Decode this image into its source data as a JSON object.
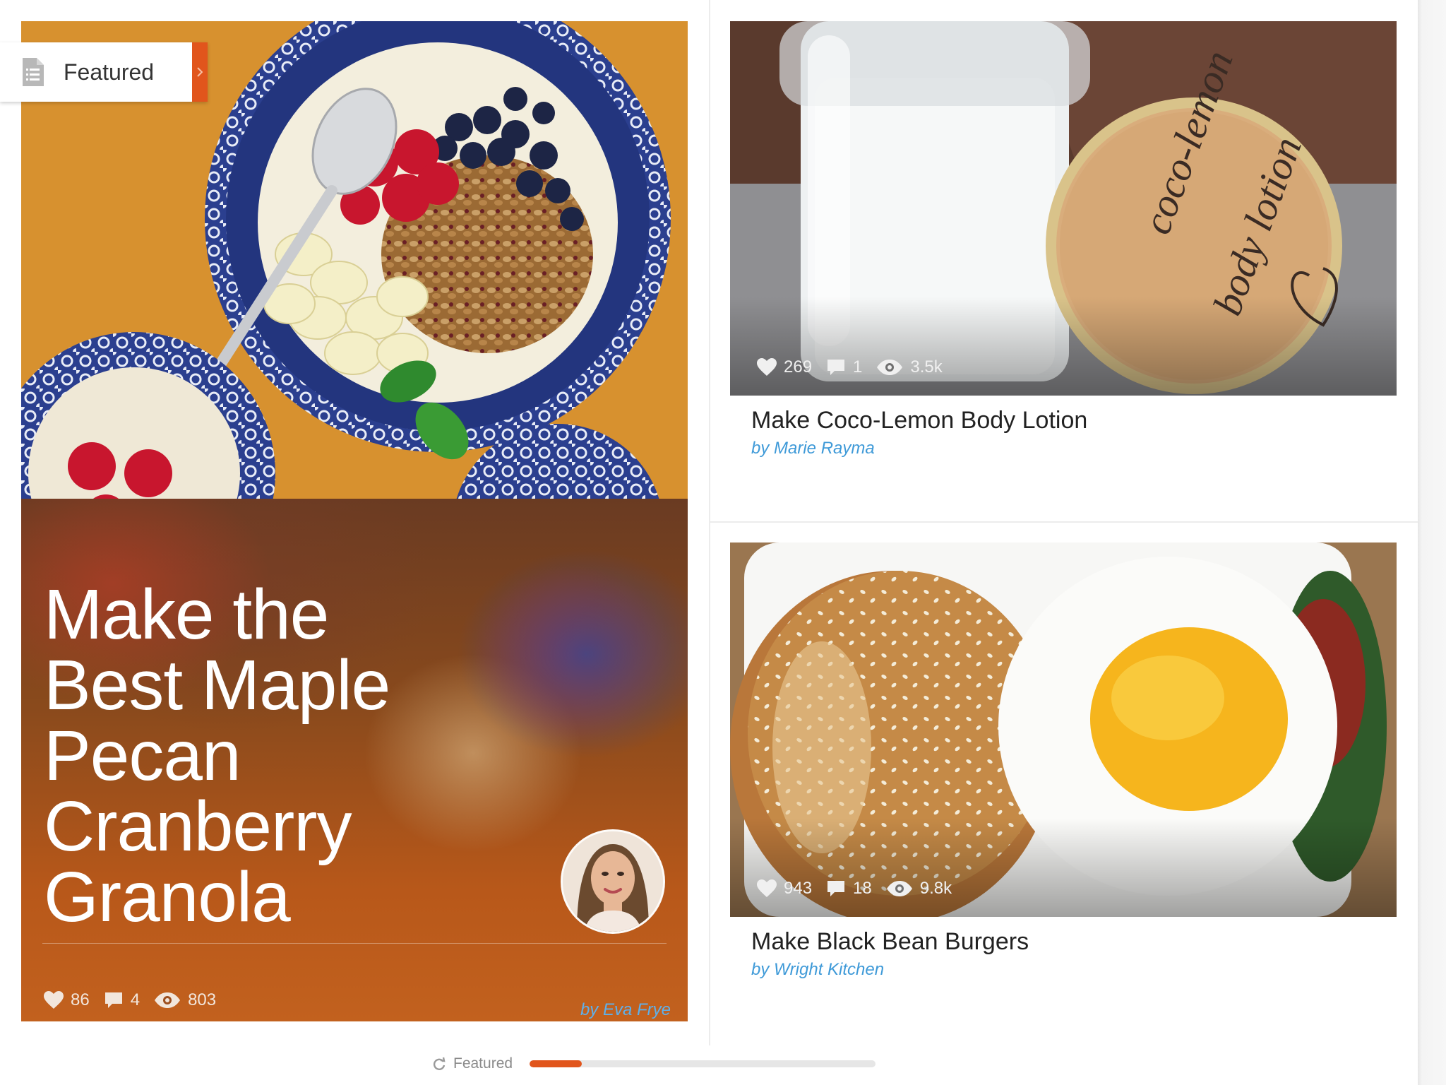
{
  "featured_tab": {
    "label": "Featured",
    "icon": "document-list-icon"
  },
  "hero": {
    "title": "Make the Best Maple Pecan Cranberry Granola",
    "author": "by Eva Frye",
    "stats": {
      "likes": "86",
      "comments": "4",
      "views": "803"
    },
    "image": "granola-bowl-photo",
    "avatar": "author-avatar-photo"
  },
  "cards": [
    {
      "title": "Make Coco-Lemon Body Lotion",
      "author": "by Marie Rayma",
      "stats": {
        "likes": "269",
        "comments": "1",
        "views": "3.5k"
      },
      "image": "lotion-jar-photo",
      "lid_text": [
        "coco-lemon",
        "body lotion"
      ]
    },
    {
      "title": "Make Black Bean Burgers",
      "author": "by Wright Kitchen",
      "stats": {
        "likes": "943",
        "comments": "18",
        "views": "9.8k"
      },
      "image": "burger-egg-photo"
    }
  ],
  "pager": {
    "label": "Featured",
    "icon": "refresh-icon",
    "progress": 0.15
  },
  "colors": {
    "accent": "#e1551c",
    "author_link": "#3f9ad8",
    "text": "#222222"
  }
}
